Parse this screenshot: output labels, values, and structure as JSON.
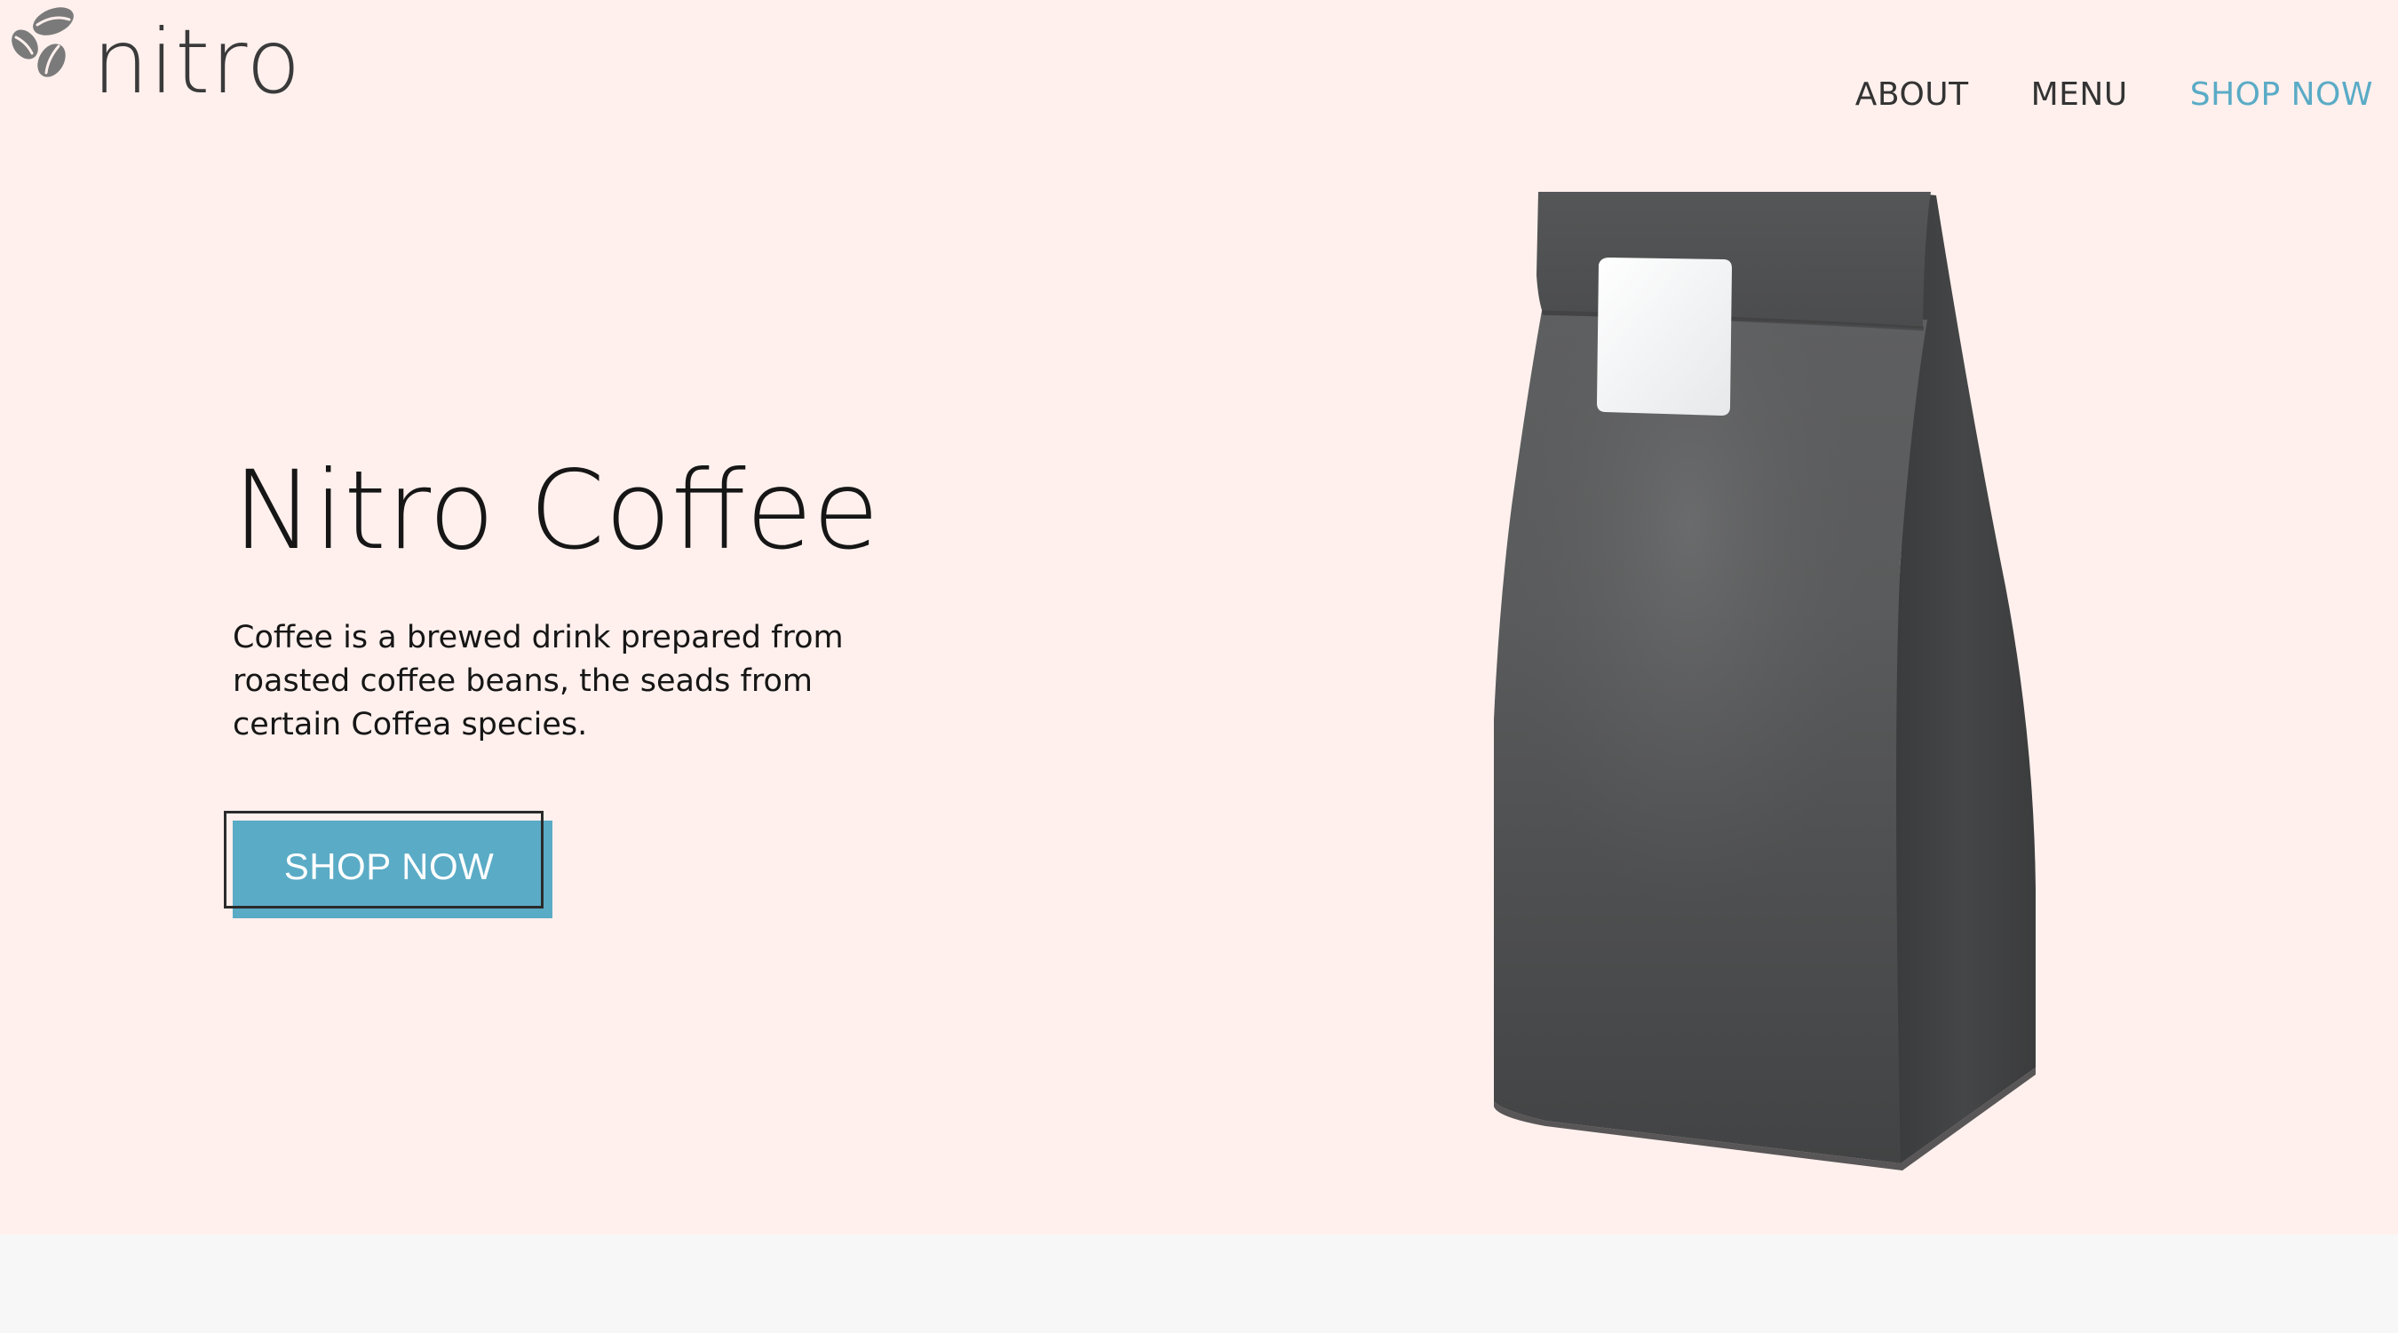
{
  "brand": {
    "name": "nitro",
    "icon": "coffee-beans-icon"
  },
  "nav": {
    "items": [
      {
        "label": "ABOUT"
      },
      {
        "label": "MENU"
      },
      {
        "label": "SHOP NOW",
        "active": true
      }
    ]
  },
  "hero": {
    "title": "Nitro Coffee",
    "description": "Coffee is a brewed drink prepared from roasted coffee beans, the seads from certain Coffea species.",
    "cta_label": "SHOP NOW",
    "image": "coffee-bag"
  },
  "colors": {
    "hero_background": "#fff0ed",
    "accent": "#5aabc6",
    "footer_strip": "#f7f7f7",
    "text": "#161616"
  }
}
